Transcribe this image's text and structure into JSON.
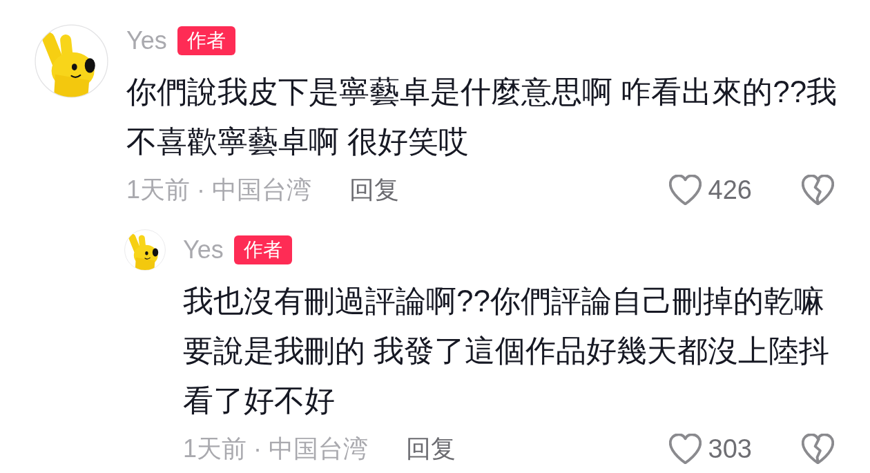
{
  "comments": [
    {
      "author": "Yes",
      "badge": "作者",
      "text": "你們說我皮下是寧藝卓是什麼意思啊 咋看出來的??我不喜歡寧藝卓啊 很好笑哎",
      "time_location": "1天前 · 中国台湾",
      "reply_action": "回复",
      "like_count": "426",
      "liked": false,
      "disliked": false,
      "replies": [
        {
          "author": "Yes",
          "badge": "作者",
          "text": "我也沒有刪過評論啊??你們評論自己刪掉的乾嘛要說是我刪的 我發了這個作品好幾天都沒上陸抖看了好不好",
          "time_location": "1天前 · 中国台湾",
          "reply_action": "回复",
          "like_count": "303",
          "liked": false,
          "disliked": false
        }
      ]
    }
  ]
}
